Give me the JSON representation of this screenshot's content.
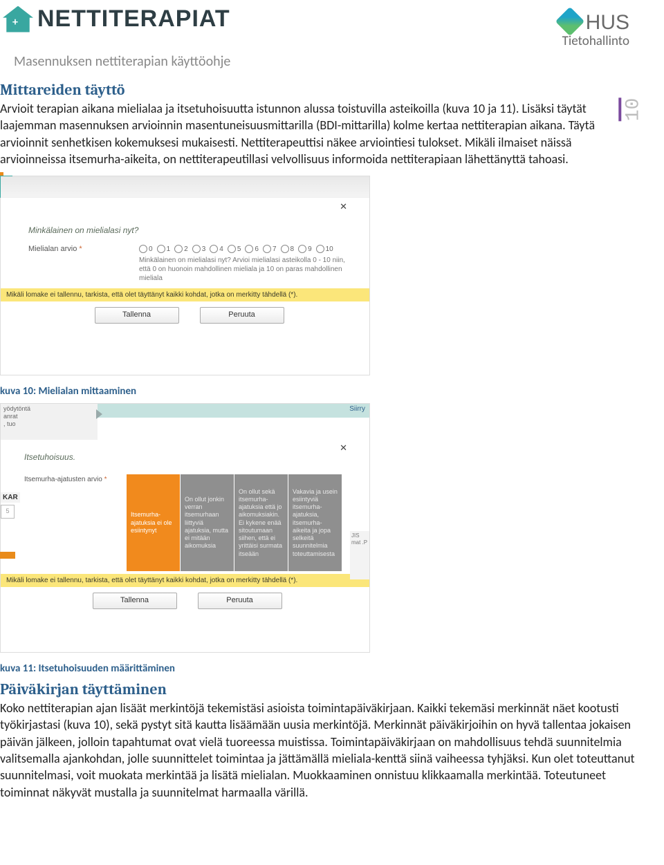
{
  "header": {
    "logo_word": "NETTITERAPIAT",
    "hus_main": "HUS",
    "hus_sub": "Tietohallinto",
    "doc_title": "Masennuksen nettiterapian käyttöohje",
    "page_number": "10"
  },
  "section1": {
    "heading": "Mittareiden täyttö",
    "body": "Arvioit terapian aikana mielialaa ja itsetuhoisuutta istunnon alussa toistuvilla asteikoilla (kuva 10 ja 11). Lisäksi täytät laajemman masennuksen arvioinnin masentuneisuusmittarilla (BDI-mittarilla) kolme kertaa nettiterapian aikana. Täytä arvioinnit senhetkisen kokemuksesi mukaisesti. Nettiterapeuttisi näkee arviointiesi tulokset. Mikäli ilmaiset näissä arvioinneissa itsemurha-aikeita, on nettiterapeutillasi velvollisuus informoida nettiterapiaan lähettänyttä tahoasi."
  },
  "figure10": {
    "question": "Minkälainen on mielialasi nyt?",
    "field_label": "Mielialan arvio",
    "scale": [
      "0",
      "1",
      "2",
      "3",
      "4",
      "5",
      "6",
      "7",
      "8",
      "9",
      "10"
    ],
    "hint": "Minkälainen on mielialasi nyt? Arvioi mielialasi asteikolla 0 - 10 niin, että 0 on huonoin mahdollinen mieliala ja 10 on paras mahdollinen mieliala",
    "warn": "Mikäli lomake ei tallennu, tarkista, että olet täyttänyt kaikki kohdat, jotka on merkitty tähdellä (*).",
    "btn_save": "Tallenna",
    "btn_cancel": "Peruuta",
    "caption": "kuva  10: Mielialan mittaaminen"
  },
  "figure11": {
    "bg_text1": "yödytöntä",
    "bg_text2": "anrat",
    "bg_text3": ", tuo",
    "siirry": "Siirry",
    "title": "Itsetuhoisuus.",
    "field_label": "Itsemurha-ajatusten arvio",
    "side_kar": "KAR",
    "side_box": "5",
    "options": [
      "Itsemurha-ajatuksia ei ole esiintynyt",
      "On ollut jonkin verran itsemurhaan liittyviä ajatuksia, mutta ei mitään aikomuksia",
      "On ollut sekä itsemurha-ajatuksia että jo aikomuksiakin. Ei kykene enää sitoutumaan siihen, että ei yrittäisi surmata itseään",
      "Vakavia ja usein esiintyviä itsemurha-ajatuksia, itsemurha-aikeita ja jopa selkeitä suunnitelmia toteuttamisesta"
    ],
    "peek_right": "JIS\nmat\n.P",
    "warn": "Mikäli lomake ei tallennu, tarkista, että olet täyttänyt kaikki kohdat, jotka on merkitty tähdellä (*).",
    "btn_save": "Tallenna",
    "btn_cancel": "Peruuta",
    "caption": "kuva  11: Itsetuhoisuuden määrittäminen"
  },
  "section2": {
    "heading": "Päiväkirjan täyttäminen",
    "body": "Koko nettiterapian ajan lisäät merkintöjä tekemistäsi asioista toimintapäiväkirjaan. Kaikki tekemäsi merkinnät näet kootusti työkirjastasi (kuva 10), sekä pystyt sitä kautta lisäämään uusia merkintöjä. Merkinnät päiväkirjoihin on hyvä tallentaa jokaisen päivän jälkeen, jolloin tapahtumat ovat vielä tuoreessa muistissa. Toimintapäiväkirjaan on mahdollisuus tehdä suunnitelmia valitsemalla ajankohdan, jolle suunnittelet toimintaa ja jättämällä mieliala-kenttä siinä vaiheessa tyhjäksi. Kun olet toteuttanut suunnitelmasi, voit muokata merkintää ja lisätä mielialan. Muokkaaminen onnistuu klikkaamalla merkintää. Toteutuneet toiminnat näkyvät mustalla ja suunnitelmat harmaalla värillä."
  }
}
